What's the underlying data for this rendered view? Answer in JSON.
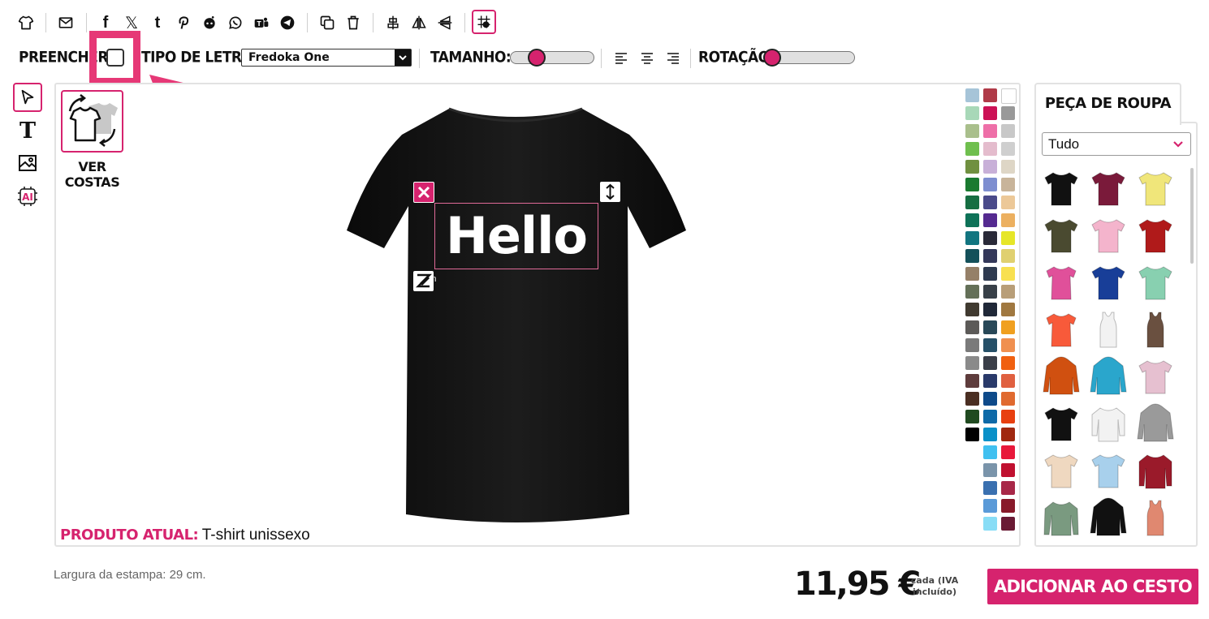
{
  "toolbar": {
    "icons": [
      "tshirt-icon",
      "email-icon",
      "facebook-icon",
      "x-twitter-icon",
      "tumblr-icon",
      "pinterest-icon",
      "reddit-icon",
      "whatsapp-icon",
      "teams-icon",
      "telegram-icon",
      "duplicate-icon",
      "trash-icon",
      "align-center-icon",
      "flip-horizontal-icon",
      "flip-vertical-icon",
      "grid-snap-icon"
    ]
  },
  "controls": {
    "fill_label": "PREENCHER:",
    "font_label": "TIPO DE LETRA:",
    "font_value": "Fredoka One",
    "size_label": "TAMANHO:",
    "size_level": 0.28,
    "rotation_label": "ROTAÇÃO:",
    "rotation_level": 0.0
  },
  "tools": [
    "select-tool-icon",
    "text-tool-icon",
    "image-tool-icon",
    "ai-tool-icon"
  ],
  "view_back": {
    "label_line1": "VER",
    "label_line2": "COSTAS"
  },
  "design": {
    "text": "Hello",
    "width_label": "29cm"
  },
  "product": {
    "current_label": "PRODUTO ATUAL:",
    "current_name": "T-shirt unissexo"
  },
  "colors": {
    "accent": "#d6236e",
    "shirt": "#111111",
    "palette": [
      [
        "#a6c4d8",
        "#b03a48",
        "#ffffff"
      ],
      [
        "#a8d8b8",
        "#cc1155",
        "#999999"
      ],
      [
        "#a9bf8c",
        "#ee6fa8",
        "#c8c8c8"
      ],
      [
        "#6fbf4e",
        "#e4bccd",
        "#cfcfcf"
      ],
      [
        "#709040",
        "#c8b0d8",
        "#ded6c6"
      ],
      [
        "#1a7a30",
        "#7e8ed0",
        "#c8b49a"
      ],
      [
        "#166e42",
        "#4a4a8a",
        "#ecc898"
      ],
      [
        "#0e7258",
        "#552a90",
        "#ecb060"
      ],
      [
        "#127580",
        "#2a2a38",
        "#e6e628"
      ],
      [
        "#14505a",
        "#34385a",
        "#e0d070"
      ],
      [
        "#958068",
        "#2e3a50",
        "#f8e050"
      ],
      [
        "#647058",
        "#384048",
        "#b89e78"
      ],
      [
        "#403a30",
        "#202838",
        "#a07840"
      ],
      [
        "#5c5a58",
        "#284858",
        "#f0a020"
      ],
      [
        "#7a7a7a",
        "#265068",
        "#f09050"
      ],
      [
        "#8a8a8a",
        "#3a3e48",
        "#f06010"
      ],
      [
        "#5e3c3c",
        "#2a3a6a",
        "#e06040"
      ],
      [
        "#4a2e22",
        "#0e4a8a",
        "#e06a30"
      ],
      [
        "#204a20",
        "#0e6aa8",
        "#e84010"
      ],
      [
        "#000000",
        "#0a90c8",
        "#a02810"
      ],
      [
        null,
        "#40c0f0",
        "#e8183a"
      ],
      [
        null,
        "#7a94aa",
        "#c01030"
      ],
      [
        null,
        "#3a70b0",
        "#a82848"
      ],
      [
        null,
        "#5a9ad8",
        "#881a2a"
      ],
      [
        null,
        "#88ddf6",
        "#6a1a34"
      ]
    ]
  },
  "garment_panel": {
    "tab_label": "PEÇA DE ROUPA",
    "filter_value": "Tudo",
    "items": [
      {
        "type": "tee",
        "color": "#111111"
      },
      {
        "type": "tee",
        "color": "#7a1a3a"
      },
      {
        "type": "tee",
        "color": "#f0e67a"
      },
      {
        "type": "tee",
        "color": "#4a4a30"
      },
      {
        "type": "tee",
        "color": "#f4b4cc"
      },
      {
        "type": "tee",
        "color": "#b01a1a"
      },
      {
        "type": "tee-fitted",
        "color": "#e0509a"
      },
      {
        "type": "tee",
        "color": "#183e98"
      },
      {
        "type": "tee",
        "color": "#88d0b0"
      },
      {
        "type": "tee-fitted",
        "color": "#f85a3a"
      },
      {
        "type": "tank",
        "color": "#f2f2f2"
      },
      {
        "type": "tank",
        "color": "#6a5040"
      },
      {
        "type": "hoodie",
        "color": "#d05010"
      },
      {
        "type": "hoodie",
        "color": "#2aa6cc"
      },
      {
        "type": "tee",
        "color": "#e6c0d0"
      },
      {
        "type": "tee",
        "color": "#111111"
      },
      {
        "type": "raglan",
        "color": "#f2f2f2"
      },
      {
        "type": "hoodie",
        "color": "#9a9a9a"
      },
      {
        "type": "tee",
        "color": "#efd8c0"
      },
      {
        "type": "tee",
        "color": "#a8d0ec"
      },
      {
        "type": "jacket",
        "color": "#9a1a2a"
      },
      {
        "type": "longsleeve",
        "color": "#7a9a80"
      },
      {
        "type": "hoodie",
        "color": "#111111"
      },
      {
        "type": "tank",
        "color": "#e08870"
      }
    ]
  },
  "footer": {
    "print_width": "Largura da estampa: 29 cm.",
    "price": "11,95 €",
    "vat_line1": "cada (IVA",
    "vat_line2": "incluído)",
    "add_to_cart": "ADICIONAR AO CESTO"
  }
}
